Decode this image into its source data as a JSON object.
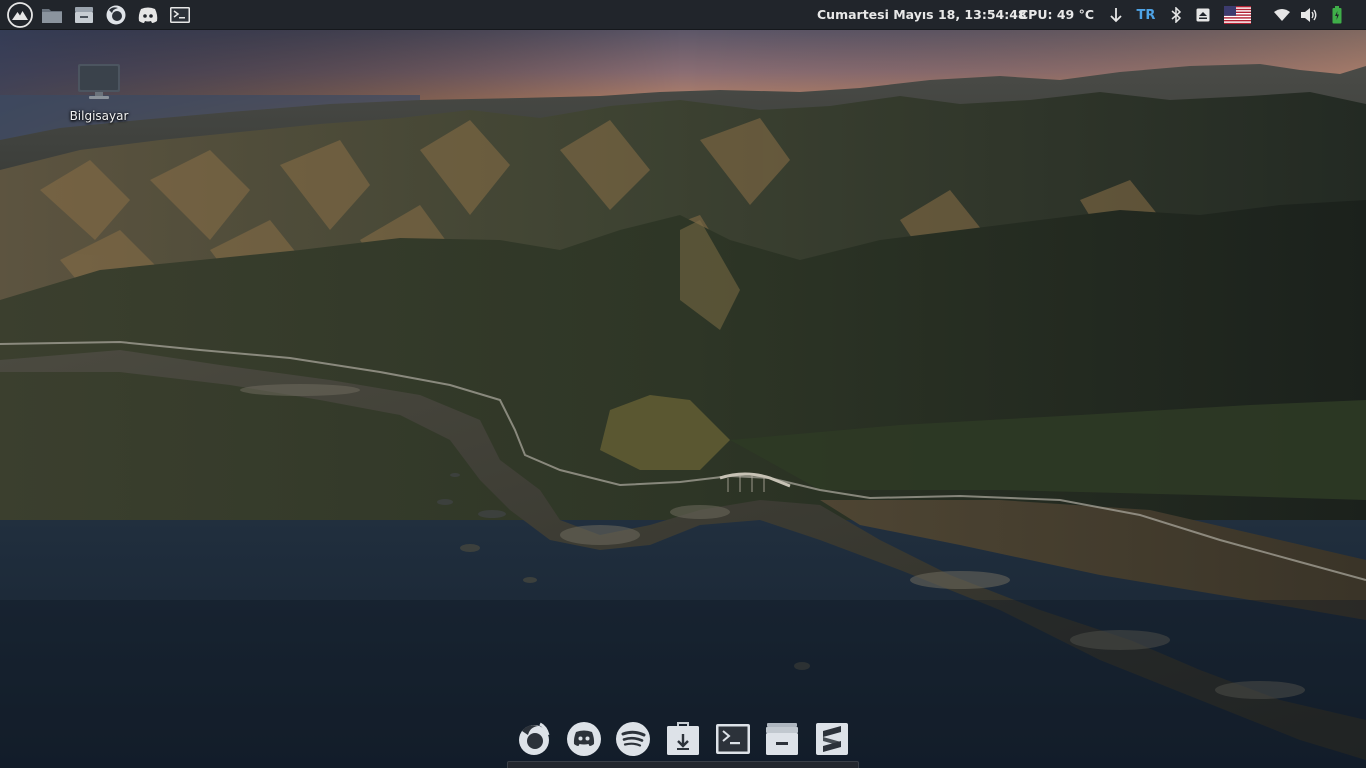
{
  "panel": {
    "launchers": [
      {
        "name": "App Menu",
        "icon": "mountain-logo-icon"
      },
      {
        "name": "Files",
        "icon": "folder-icon"
      },
      {
        "name": "File Manager",
        "icon": "drawer-icon"
      },
      {
        "name": "Firefox",
        "icon": "firefox-icon"
      },
      {
        "name": "Discord",
        "icon": "discord-icon"
      },
      {
        "name": "Terminal",
        "icon": "terminal-icon"
      }
    ],
    "clock": "Cumartesi Mayıs 18, 13:54:48",
    "cpu": "CPU: 49 °C",
    "keyboard_layout": "TR",
    "tray_icons": [
      "download-arrow-icon",
      "bluetooth-icon",
      "eject-icon",
      "us-flag-icon",
      "wifi-icon",
      "volume-icon",
      "battery-icon"
    ]
  },
  "desktop": {
    "icons": [
      {
        "label": "Bilgisayar",
        "icon": "computer-icon"
      }
    ]
  },
  "dock": {
    "items": [
      {
        "name": "Firefox",
        "icon": "firefox-icon"
      },
      {
        "name": "Discord",
        "icon": "discord-icon"
      },
      {
        "name": "Spotify",
        "icon": "spotify-icon"
      },
      {
        "name": "Software Installer",
        "icon": "package-install-icon"
      },
      {
        "name": "Terminal",
        "icon": "terminal-icon"
      },
      {
        "name": "File Manager",
        "icon": "drawer-icon"
      },
      {
        "name": "Sublime Text",
        "icon": "sublime-text-icon"
      }
    ]
  },
  "colors": {
    "panel_bg": "#21252b",
    "panel_text": "#e8e8e8",
    "keyboard_layout_accent": "#4ea3e6",
    "battery_green": "#3fae49"
  }
}
